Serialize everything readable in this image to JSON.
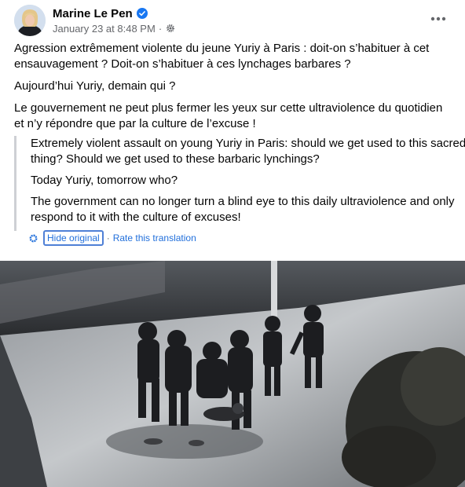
{
  "post": {
    "author": "Marine Le Pen",
    "timestamp": "January 23 at 8:48 PM",
    "separator": "·",
    "paragraphs": [
      "Agression extrêmement violente du jeune Yuriy à Paris : doit-on s’habituer à cet ensauvagement ? Doit-on s’habituer à ces lynchages barbares ?",
      "Aujourd’hui Yuriy, demain qui ?",
      "Le gouvernement ne peut plus fermer les yeux sur cette ultraviolence du quotidien et n’y répondre que par la culture de l’excuse !"
    ]
  },
  "translation": {
    "paragraphs": [
      "Extremely violent assault on young Yuriy in Paris: should we get used to this sacred thing? Should we get used to these barbaric lynchings?",
      "Today Yuriy, tomorrow who?",
      "The government can no longer turn a blind eye to this daily ultraviolence and only respond to it with the culture of excuses!"
    ],
    "hide_label": "Hide original",
    "separator": "·",
    "rate_label": "Rate this translation"
  },
  "icons": {
    "verified": "verified-badge-icon",
    "audience": "gear-icon",
    "more": "more-options-icon",
    "translate": "gear-icon"
  },
  "colors": {
    "link": "#216fdb",
    "verified": "#1877f2",
    "secondary_text": "#65676b"
  }
}
